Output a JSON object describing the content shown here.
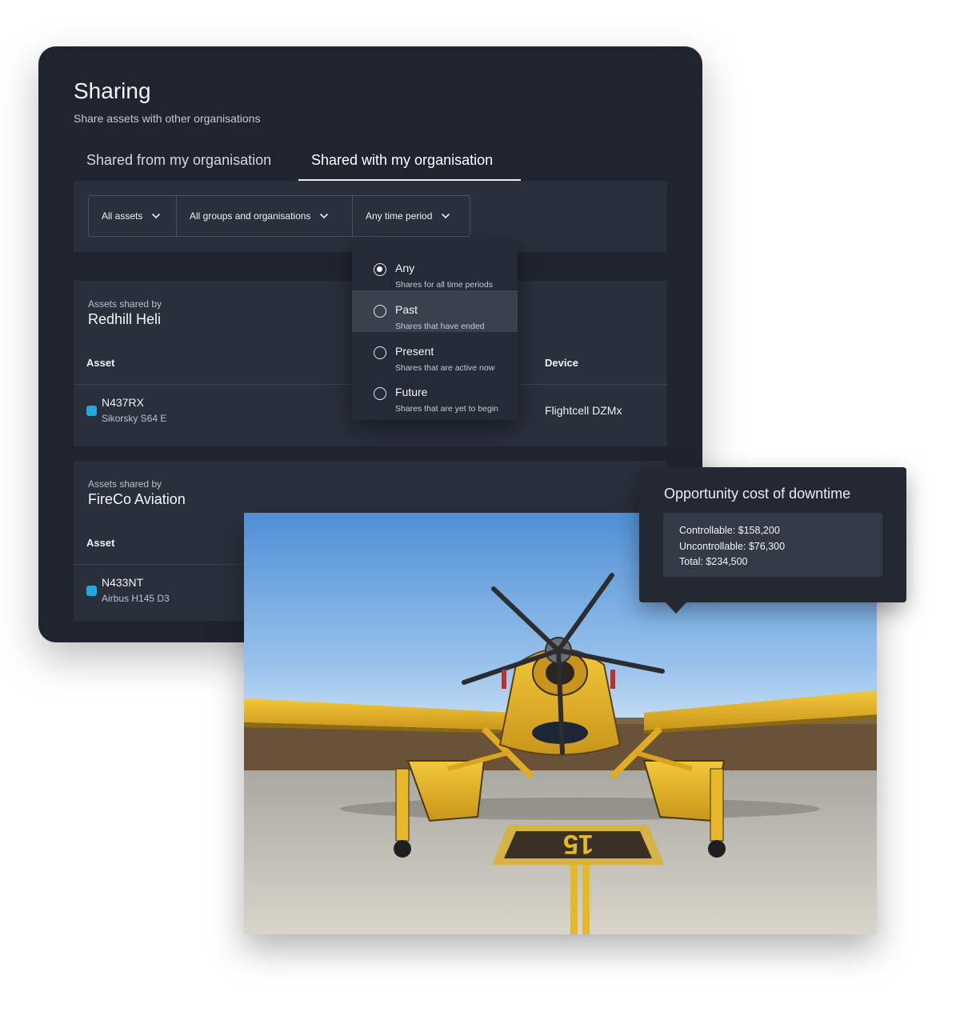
{
  "header": {
    "title": "Sharing",
    "subtitle": "Share assets with other organisations"
  },
  "tabs": [
    {
      "label": "Shared from my organisation",
      "active": false
    },
    {
      "label": "Shared with my organisation",
      "active": true
    }
  ],
  "filters": {
    "assets": "All assets",
    "groups": "All groups and organisations",
    "time_period": "Any time period"
  },
  "time_period_menu": {
    "selected": "Any",
    "hovered": "Past",
    "options": [
      {
        "label": "Any",
        "description": "Shares for all time periods"
      },
      {
        "label": "Past",
        "description": "Shares that have ended"
      },
      {
        "label": "Present",
        "description": "Shares that are active now"
      },
      {
        "label": "Future",
        "description": "Shares that are yet to begin"
      }
    ]
  },
  "cards": [
    {
      "kicker": "Assets shared by",
      "org": "Redhill Heli",
      "columns": {
        "asset": "Asset",
        "device": "Device"
      },
      "rows": [
        {
          "id": "N437RX",
          "model": "Sikorsky S64 E",
          "device": "Flightcell DZMx",
          "color": "#22a7e0"
        }
      ]
    },
    {
      "kicker": "Assets shared by",
      "org": "FireCo Aviation",
      "columns": {
        "asset": "Asset"
      },
      "rows": [
        {
          "id": "N433NT",
          "model": "Airbus H145 D3",
          "color": "#22a7e0"
        }
      ]
    }
  ],
  "tooltip": {
    "title": "Opportunity cost of downtime",
    "lines": [
      "Controllable: $158,200",
      "Uncontrollable: $76,300",
      "Total: $234,500"
    ]
  },
  "icons": {
    "chevron": "chevron-down-icon",
    "radio": "radio-icon"
  },
  "colors": {
    "panel_bg": "#1f242e",
    "card_bg": "#292f3b",
    "asset_marker": "#22a7e0",
    "aircraft_yellow": "#e9b52a"
  }
}
